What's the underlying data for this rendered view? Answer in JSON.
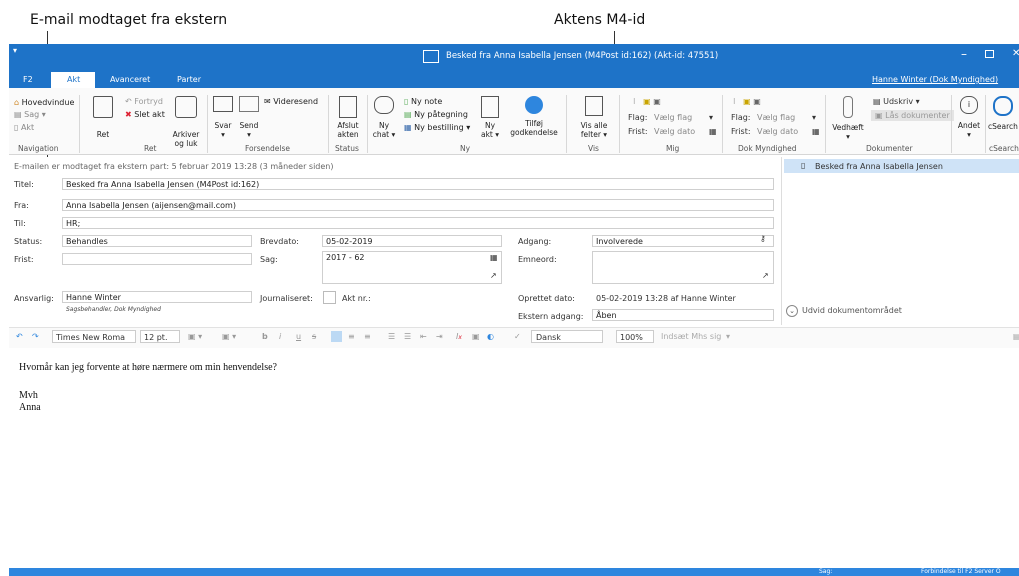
{
  "annotations": {
    "left": "E-mail modtaget fra ekstern",
    "right": "Aktens M4-id"
  },
  "window": {
    "title": "Besked fra Anna Isabella Jensen (M4Post id:162) (Akt-id: 47551)",
    "user": "Hanne Winter (Dok Myndighed)"
  },
  "tabs": [
    "F2",
    "Akt",
    "Avanceret",
    "Parter"
  ],
  "ribbon": {
    "hovedvindue": "Hovedvindue",
    "sag": "Sag",
    "akt": "Akt",
    "navigation": "Navigation",
    "ret": "Ret",
    "fortryd": "Fortryd",
    "slet_akt": "Slet akt",
    "arkiver1": "Arkiver",
    "arkiver2": "og luk",
    "ret_group": "Ret",
    "svar": "Svar",
    "send": "Send",
    "videresend": "Videresend",
    "forsendelse": "Forsendelse",
    "afslut1": "Afslut",
    "afslut2": "akten",
    "status": "Status",
    "ny_chat1": "Ny",
    "ny_chat2": "chat",
    "ny_note": "Ny note",
    "ny_paategning": "Ny påtegning",
    "ny_bestilling": "Ny bestilling",
    "ny_akt1": "Ny",
    "ny_akt2": "akt",
    "tilfoej1": "Tilføj",
    "tilfoej2": "godkendelse",
    "ny_group": "Ny",
    "vis_alle1": "Vis alle",
    "vis_alle2": "felter",
    "vis": "Vis",
    "flag": "Flag:",
    "vaelg_flag": "Vælg flag",
    "frist": "Frist:",
    "vaelg_dato": "Vælg dato",
    "mig": "Mig",
    "dok_myndighed": "Dok Myndighed",
    "vedhaeft": "Vedhæft",
    "udskriv": "Udskriv",
    "laas": "Lås dokumenter",
    "dokumenter": "Dokumenter",
    "andet": "Andet",
    "csearch": "cSearch"
  },
  "info_line": "E-mailen er modtaget fra ekstern part:  5 februar 2019 13:28 (3 måneder siden)",
  "form": {
    "titel_label": "Titel:",
    "titel_value": "Besked fra Anna Isabella Jensen (M4Post id:162)",
    "fra_label": "Fra:",
    "fra_value": "Anna Isabella Jensen (aijensen@mail.com)",
    "til_label": "Til:",
    "til_value": "HR;",
    "status_label": "Status:",
    "status_value": "Behandles",
    "brevdato_label": "Brevdato:",
    "brevdato_value": "05-02-2019",
    "adgang_label": "Adgang:",
    "adgang_value": "Involverede",
    "frist_label": "Frist:",
    "sag_label": "Sag:",
    "sag_value": "2017 - 62",
    "emneord_label": "Emneord:",
    "ansvarlig_label": "Ansvarlig:",
    "ansvarlig_value": "Hanne Winter",
    "ansvarlig_sub": "Sagsbehandler, Dok Myndighed",
    "journaliseret_label": "Journaliseret:",
    "akt_nr": "Akt nr.:",
    "oprettet_label": "Oprettet dato:",
    "oprettet_value": "05-02-2019 13:28   af   Hanne Winter",
    "ekstern_label": "Ekstern adgang:",
    "ekstern_value": "Åben"
  },
  "doc_panel": {
    "item": "Besked fra Anna Isabella Jensen",
    "expand": "Udvid dokumentområdet"
  },
  "toolbar": {
    "font": "Times New Roma",
    "size": "12 pt.",
    "language": "Dansk",
    "zoom": "100%",
    "insert_field": "Indsæt Mhs sig"
  },
  "body_text": {
    "line1": "Hvornår kan jeg forvente at høre nærmere om min henvendelse?",
    "line2": "Mvh",
    "line3": "Anna"
  },
  "statusbar": {
    "left": "Sag:",
    "right": "Forbindelse til F2 Server O"
  },
  "colors": {
    "titlebar": "#1e73c8",
    "selected": "#cfe3f7",
    "accent": "#2e86de"
  }
}
